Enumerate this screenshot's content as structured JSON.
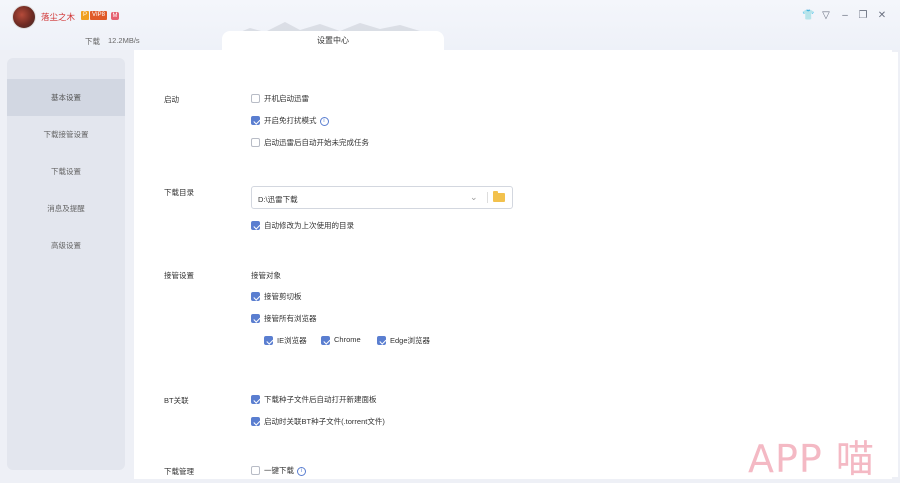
{
  "user": {
    "name": "落尘之木",
    "badge_p": "P",
    "badge_vip": "VIP8",
    "badge_m": "M"
  },
  "download": {
    "label": "下载",
    "speed": "12.2MB/s"
  },
  "tab": {
    "title": "设置中心"
  },
  "window_controls": {
    "skin": "👕",
    "menu": "▽",
    "minimize": "–",
    "restore": "❐",
    "close": "✕"
  },
  "sidebar": {
    "items": [
      {
        "label": "基本设置",
        "active": true
      },
      {
        "label": "下载接管设置",
        "active": false
      },
      {
        "label": "下载设置",
        "active": false
      },
      {
        "label": "消息及提醒",
        "active": false
      },
      {
        "label": "高级设置",
        "active": false
      }
    ]
  },
  "sections": {
    "startup": {
      "label": "启动",
      "options": [
        {
          "text": "开机启动迅雷",
          "checked": false
        },
        {
          "text": "开启免打扰模式",
          "checked": true,
          "info": "i"
        },
        {
          "text": "启动迅雷后自动开始未完成任务",
          "checked": false
        }
      ]
    },
    "download_dir": {
      "label": "下载目录",
      "path": "D:\\迅雷下载",
      "auto_change": {
        "text": "自动修改为上次使用的目录",
        "checked": true
      }
    },
    "takeover": {
      "label": "接管设置",
      "target_label": "接管对象",
      "clipboard": {
        "text": "接管剪切板",
        "checked": true
      },
      "all_browsers": {
        "text": "接管所有浏览器",
        "checked": true
      },
      "browsers": [
        {
          "text": "IE浏览器",
          "checked": true
        },
        {
          "text": "Chrome",
          "checked": true
        },
        {
          "text": "Edge浏览器",
          "checked": true
        }
      ]
    },
    "bt": {
      "label": "BT关联",
      "options": [
        {
          "text": "下载种子文件后自动打开新建面板",
          "checked": true
        },
        {
          "text": "启动时关联BT种子文件(.torrent文件)",
          "checked": true
        }
      ]
    },
    "dl_manage": {
      "label": "下载管理",
      "options": [
        {
          "text": "一键下载",
          "checked": false,
          "info": "i"
        }
      ]
    }
  },
  "watermark": "APP 喵"
}
